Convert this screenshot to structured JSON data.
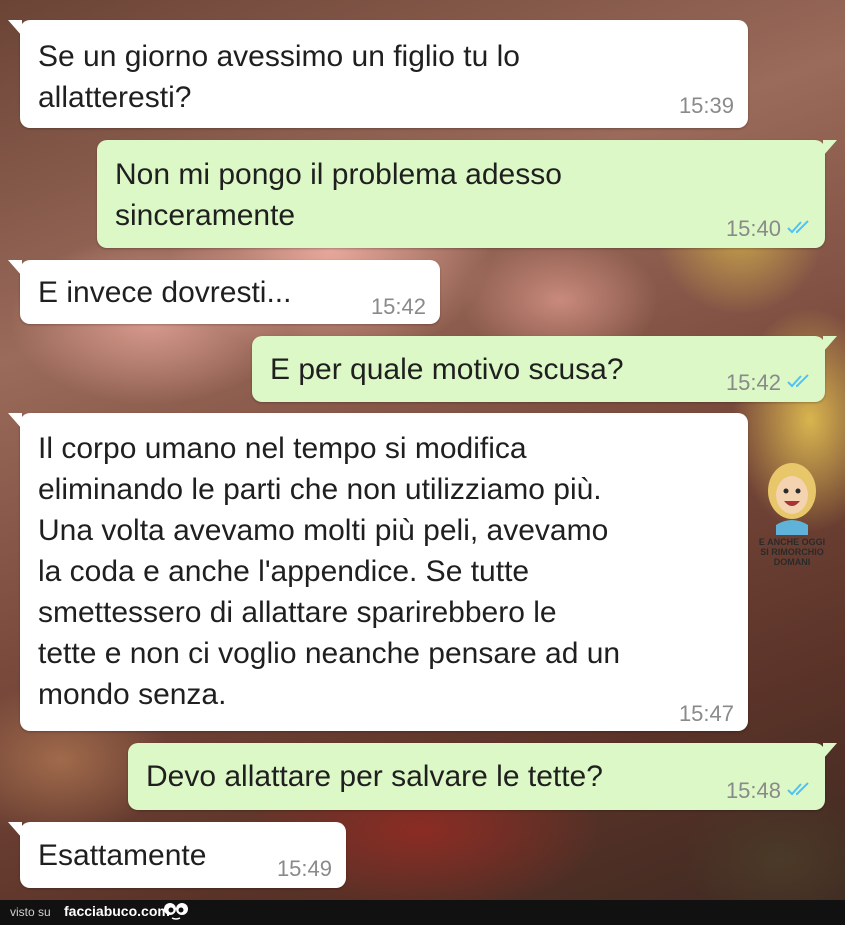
{
  "messages": [
    {
      "dir": "in",
      "text": "Se un giorno avessimo un figlio tu lo\nallatteresti?",
      "time": "15:39"
    },
    {
      "dir": "out",
      "text": "Non mi pongo il problema adesso\nsinceramente",
      "time": "15:40"
    },
    {
      "dir": "in",
      "text": "E invece dovresti...",
      "time": "15:42"
    },
    {
      "dir": "out",
      "text": "E per quale motivo scusa?",
      "time": "15:42"
    },
    {
      "dir": "in",
      "text": "Il corpo umano nel tempo si modifica\neliminando le parti che non utilizziamo più.\nUna volta avevamo molti più peli, avevamo\nla coda e anche l'appendice. Se tutte\nsmettessero di allattare sparirebbero le\ntette e non ci voglio neanche pensare ad un\nmondo senza.",
      "time": "15:47"
    },
    {
      "dir": "out",
      "text": "Devo allattare per salvare le tette?",
      "time": "15:48"
    },
    {
      "dir": "in",
      "text": "Esattamente",
      "time": "15:49"
    }
  ],
  "watermark": {
    "line1": "E ANCHE OGGI",
    "line2": "SI RIMORCHIO DOMANI"
  },
  "footer": {
    "visto": "visto su",
    "site": "facciabuco.com"
  },
  "colors": {
    "incoming": "#ffffff",
    "outgoing": "#dcf8c6",
    "read_check": "#4fc3f7"
  }
}
